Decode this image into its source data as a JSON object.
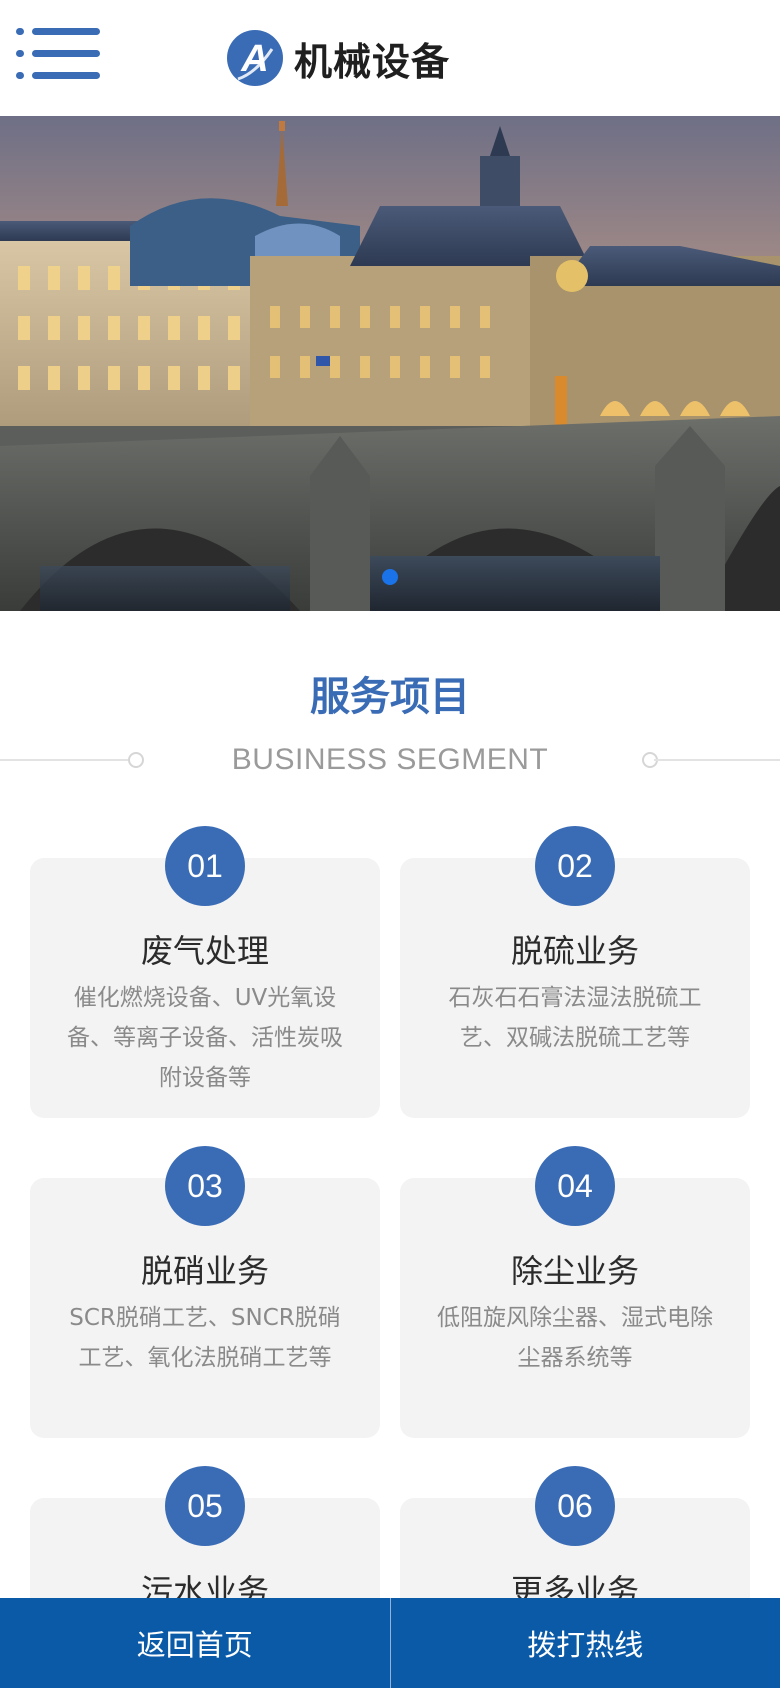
{
  "header": {
    "logo_text": "机械设备",
    "logo_letter": "A"
  },
  "banner": {
    "slide_count": 1,
    "active_index": 0
  },
  "section": {
    "title": "服务项目",
    "subtitle": "BUSINESS SEGMENT"
  },
  "services": [
    {
      "num": "01",
      "title": "废气处理",
      "desc": "催化燃烧设备、UV光氧设备、等离子设备、活性炭吸附设备等"
    },
    {
      "num": "02",
      "title": "脱硫业务",
      "desc": "石灰石石膏法湿法脱硫工艺、双碱法脱硫工艺等"
    },
    {
      "num": "03",
      "title": "脱硝业务",
      "desc": "SCR脱硝工艺、SNCR脱硝工艺、氧化法脱硝工艺等"
    },
    {
      "num": "04",
      "title": "除尘业务",
      "desc": "低阻旋风除尘器、湿式电除尘器系统等"
    },
    {
      "num": "05",
      "title": "污水业务",
      "desc": ""
    },
    {
      "num": "06",
      "title": "更多业务",
      "desc": ""
    }
  ],
  "bottom_bar": {
    "home_label": "返回首页",
    "call_label": "拨打热线"
  },
  "colors": {
    "accent": "#3a6cb5",
    "bottom_bar": "#0a5aa8",
    "banner_dot": "#1a73e8",
    "card_bg": "#f3f3f3"
  },
  "icons": {
    "menu": "menu-icon",
    "logo": "logo-icon"
  }
}
